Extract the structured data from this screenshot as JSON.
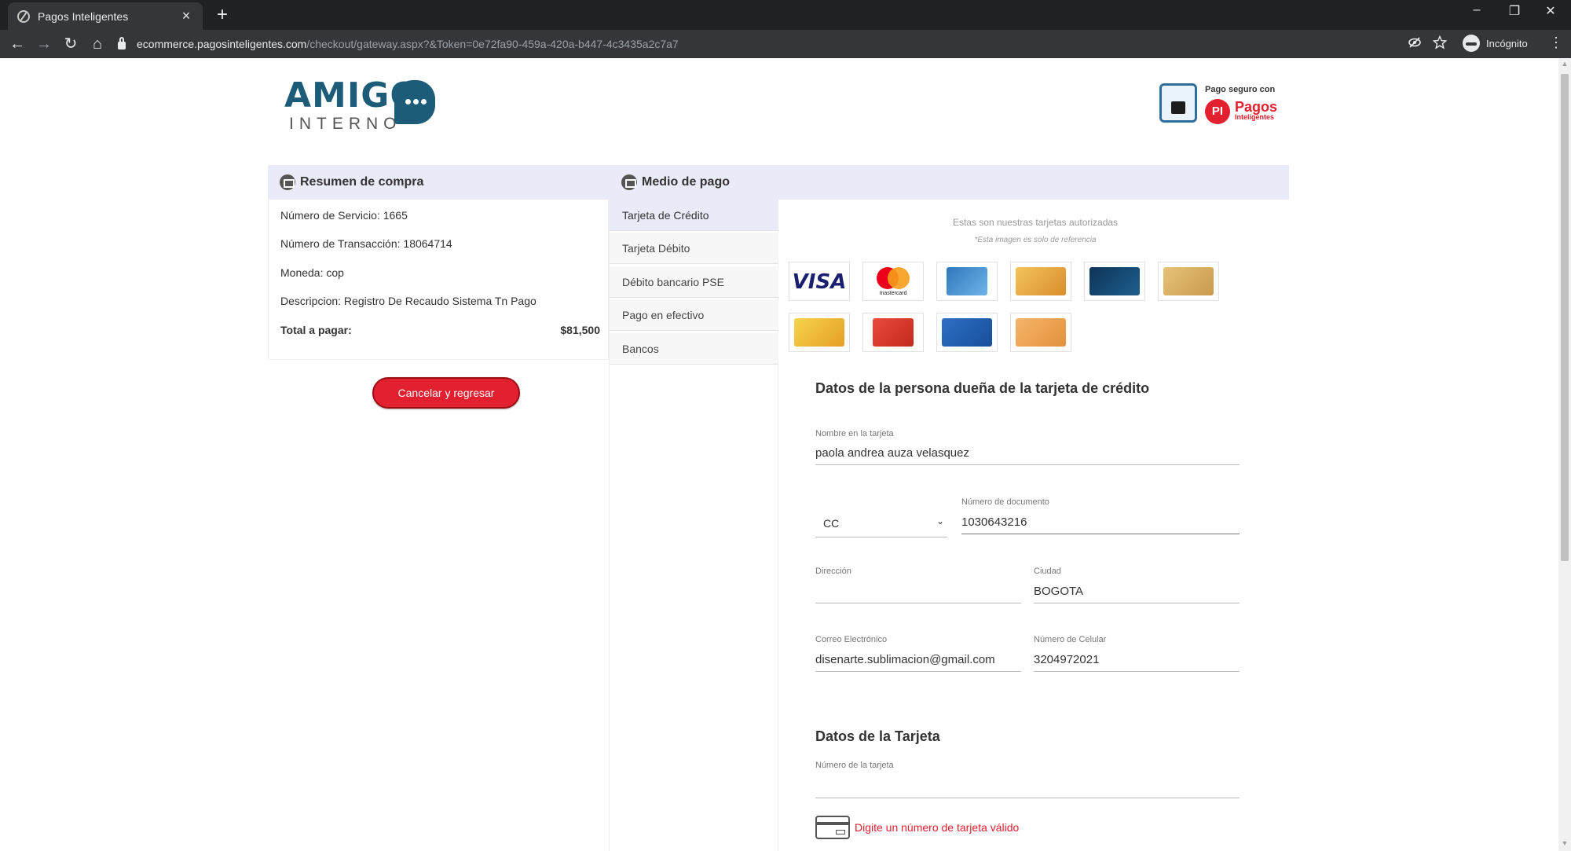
{
  "browser": {
    "tab_title": "Pagos Inteligentes",
    "tab_close": "×",
    "new_tab": "+",
    "url_host": "ecommerce.pagosinteligentes.com",
    "url_path": "/checkout/gateway.aspx?&Token=0e72fa90-459a-420a-b447-4c3435a2c7a7",
    "incognito_label": "Incógnito",
    "controls": {
      "minimize": "–",
      "restore": "❐",
      "close": "✕"
    },
    "nav": {
      "back": "←",
      "forward": "→",
      "reload": "↻",
      "home": "⌂"
    }
  },
  "brand": {
    "logo_main": "AMIGO",
    "logo_sub": "INTERNO",
    "secure_label": "Pago seguro con",
    "pi_mark": "PI",
    "pi_name": "Pagos",
    "pi_name_sub": "Inteligentes",
    "accent_color": "#e3202f",
    "logo_color": "#1d5c78"
  },
  "summary": {
    "title": "Resumen de compra",
    "rows": [
      "Número de Servicio: 1665",
      "Número de Transacción: 18064714",
      "Moneda: cop",
      "Descripcion: Registro De Recaudo Sistema Tn Pago"
    ],
    "total_label": "Total a pagar:",
    "total_value": "$81,500",
    "cancel_button": "Cancelar y regresar"
  },
  "payment": {
    "title": "Medio de pago",
    "methods": [
      {
        "label": "Tarjeta de Crédito",
        "active": true
      },
      {
        "label": "Tarjeta Débito",
        "active": false
      },
      {
        "label": "Débito bancario PSE",
        "active": false
      },
      {
        "label": "Pago en efectivo",
        "active": false
      },
      {
        "label": "Bancos",
        "active": false
      }
    ],
    "cards_title": "Estas son nuestras tarjetas autorizadas",
    "cards_note": "*Esta imagen es solo de referencia",
    "cards": [
      {
        "name": "visa-card",
        "label": "VISA"
      },
      {
        "name": "mastercard-card",
        "label": "mastercard"
      },
      {
        "name": "amex-card"
      },
      {
        "name": "gold-card-1"
      },
      {
        "name": "dark-blue-card"
      },
      {
        "name": "gold-card-2"
      },
      {
        "name": "yellow-card"
      },
      {
        "name": "red-card"
      },
      {
        "name": "blue-card"
      },
      {
        "name": "orange-card"
      }
    ]
  },
  "owner_form": {
    "title": "Datos de la persona dueña de la tarjeta de crédito",
    "name_label": "Nombre en la tarjeta",
    "name_value": "paola andrea auza velasquez",
    "doc_type_value": "CC",
    "doc_number_label": "Número de documento",
    "doc_number_value": "1030643216",
    "address_label": "Dirección",
    "address_value": "",
    "city_label": "Ciudad",
    "city_value": "BOGOTA",
    "email_label": "Correo Electrónico",
    "email_value": "disenarte.sublimacion@gmail.com",
    "phone_label": "Número de Celular",
    "phone_value": "3204972021"
  },
  "card_form": {
    "title": "Datos de la Tarjeta",
    "number_label": "Número de la tarjeta",
    "number_value": "",
    "error": "Digite un número de tarjeta válido"
  }
}
